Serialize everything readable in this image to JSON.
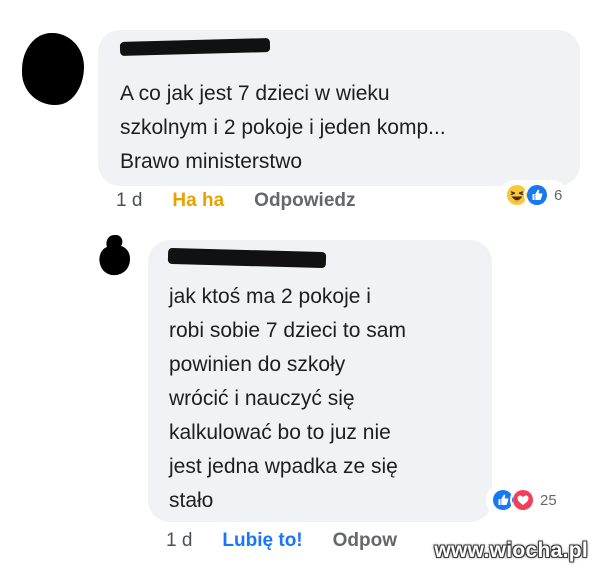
{
  "colors": {
    "bubble_bg": "#f0f2f5",
    "text": "#1c1e21",
    "meta_gray": "#65676b",
    "haha_yellow": "#e7a200",
    "like_blue": "#1877f2",
    "love_red": "#f33e58",
    "page_bg": "#ffffff"
  },
  "comments": [
    {
      "author_redacted": true,
      "avatar": "scribbled-black-circle",
      "lines": [
        "A co jak jest 7 dzieci w wieku",
        "szkolnym i 2 pokoje i jeden komp...",
        "Brawo ministerstwo"
      ],
      "time": "1 d",
      "reaction_action": "Ha ha",
      "reply_label": "Odpowiedz",
      "reactions": {
        "icons": [
          "haha-icon",
          "like-icon"
        ],
        "count": "6"
      }
    },
    {
      "author_redacted": true,
      "avatar": "scribbled-black-shape",
      "lines": [
        "jak ktoś ma 2 pokoje i",
        "robi sobie 7 dzieci to sam",
        "powinien do szkoły",
        "wrócić i nauczyć się",
        "kalkulować bo to juz nie",
        "jest jedna wpadka ze się",
        "stało"
      ],
      "time": "1 d",
      "reaction_action": "Lubię to!",
      "reply_label": "Odpow",
      "reactions": {
        "icons": [
          "like-icon",
          "love-icon"
        ],
        "count": "25"
      }
    }
  ],
  "watermark": "www.wiocha.pl"
}
